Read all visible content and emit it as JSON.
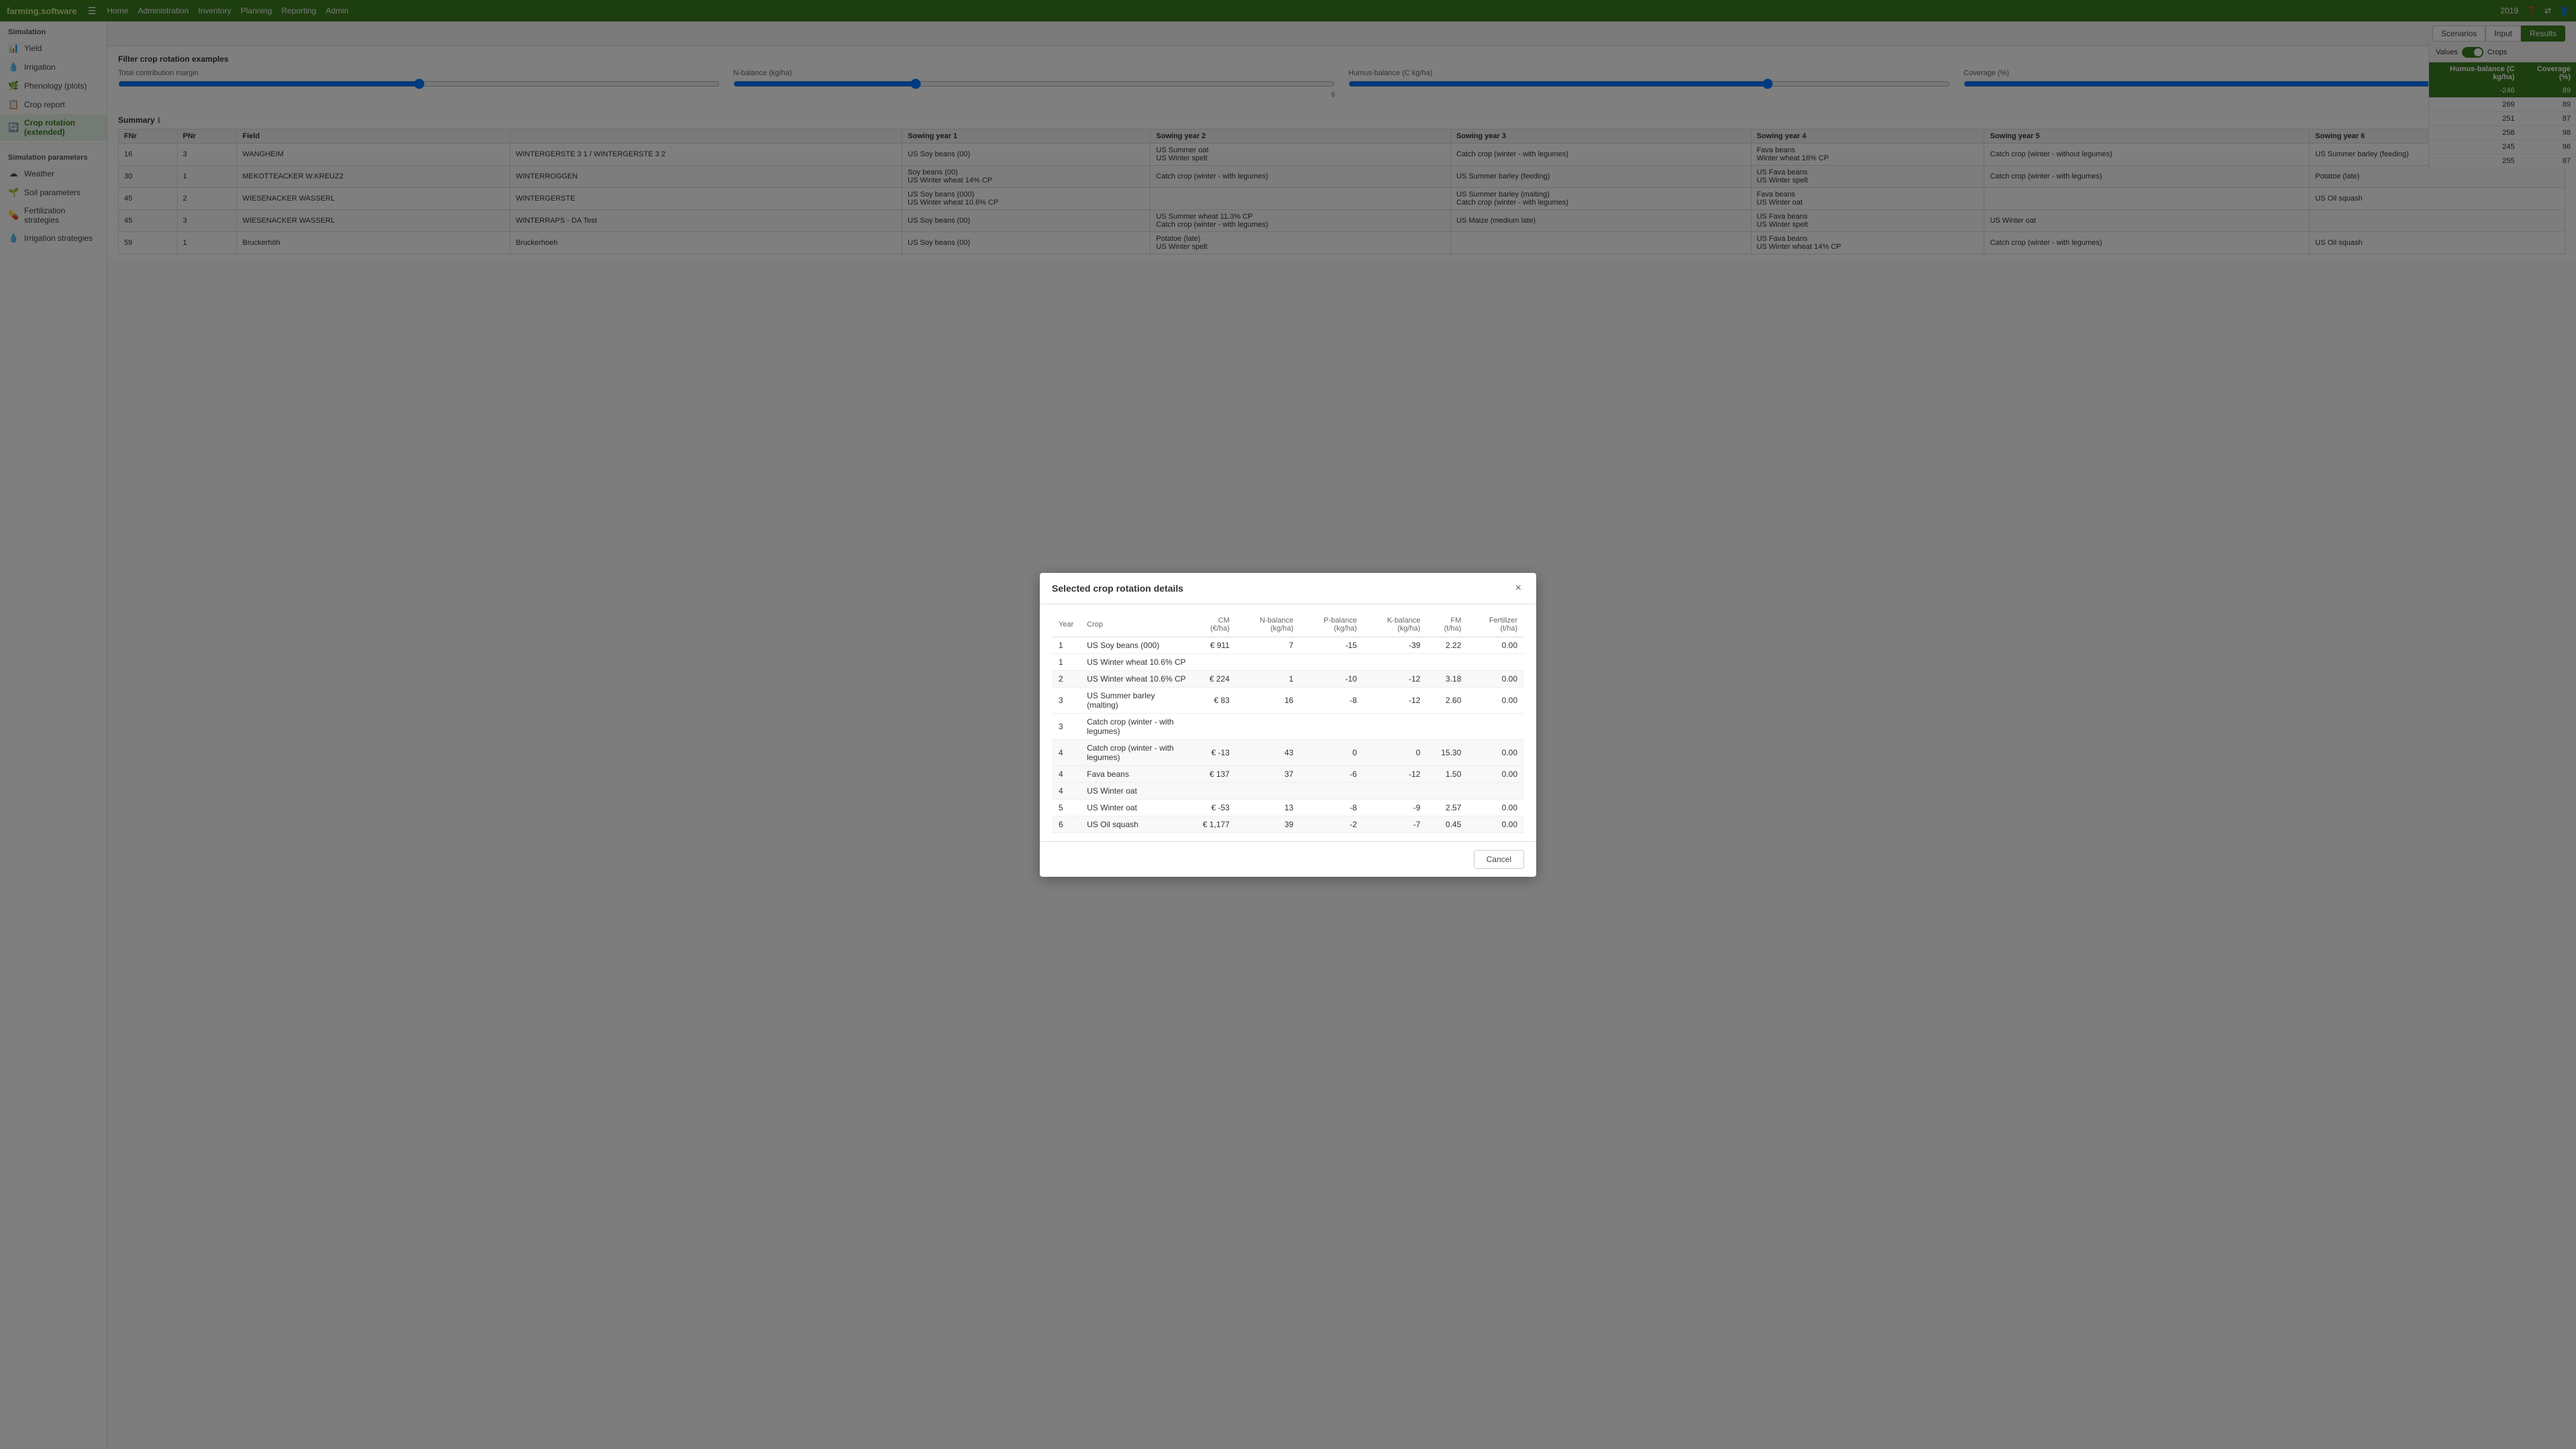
{
  "app": {
    "brand_prefix": "farming.",
    "brand_suffix": "software",
    "year": "2019"
  },
  "nav": {
    "items": [
      "Home",
      "Administration",
      "Inventory",
      "Planning",
      "Reporting",
      "Admin"
    ]
  },
  "sidebar": {
    "simulation_title": "Simulation",
    "sim_items": [
      {
        "label": "Yield",
        "icon": "📊"
      },
      {
        "label": "Irrigation",
        "icon": "💧"
      },
      {
        "label": "Phenology (plots)",
        "icon": "🌿"
      },
      {
        "label": "Crop report",
        "icon": "📋"
      },
      {
        "label": "Crop rotation (extended)",
        "icon": "🔄"
      }
    ],
    "params_title": "Simulation parameters",
    "param_items": [
      {
        "label": "Weather",
        "icon": "☁"
      },
      {
        "label": "Soil parameters",
        "icon": "🌱"
      },
      {
        "label": "Fertilization strategies",
        "icon": "💊"
      },
      {
        "label": "Irrigation strategies",
        "icon": "💧"
      }
    ]
  },
  "toolbar": {
    "scenarios_label": "Scenarios",
    "input_label": "Input",
    "results_label": "Results",
    "values_label": "Values",
    "crops_label": "Crops"
  },
  "filter": {
    "title": "Filter crop rotation examples",
    "total_cm_label": "Total contribution margin",
    "n_balance_label": "N-balance (kg/ha)",
    "humus_balance_label": "Humus-balance (C kg/ha)",
    "coverage_label": "Coverage (%)",
    "n_value": "6"
  },
  "summary": {
    "title": "Summary",
    "columns": [
      "FNr",
      "PNr",
      "Field",
      "",
      "Sowing year 1",
      "",
      "Sowing year 2",
      "",
      "Sowing year 3",
      "",
      "Sowing year 4",
      "",
      "Sowing year 5",
      "Sowing year 6"
    ],
    "rows": [
      {
        "fnr": "16",
        "pnr": "3",
        "field": "WANGHEIM",
        "type": "WINTERGERSTE 3 1 / WINTERGERSTE 3 2",
        "sy1": "US Soy beans (00)",
        "sy2": "US Summer oat\nUS Winter spelt",
        "sy3": "Catch crop (winter - with legumes)",
        "sy4": "Fava beans\nWinter wheat 16% CP",
        "sy5": "Catch crop (winter - without legumes)",
        "sy6": "US Summer barley (feeding)"
      },
      {
        "fnr": "30",
        "pnr": "1",
        "field": "MEKOTTEACKER W.KREUZ2",
        "type": "WINTERROGGEN",
        "sy1": "Soy beans (00)\nUS Winter wheat 14% CP",
        "sy2": "Catch crop (winter - with legumes)",
        "sy3": "US Summer barley (feeding)",
        "sy4": "US Fava beans\nUS Winter spelt",
        "sy5": "Catch crop (winter - with legumes)",
        "sy6": "Potatoe (late)"
      },
      {
        "fnr": "45",
        "pnr": "2",
        "field": "WIESENACKER WASSERL",
        "type": "WINTERGERSTE",
        "sy1": "US Soy beans (000)\nUS Winter wheat 10.6% CP",
        "sy2": "",
        "sy3": "US Summer barley (malting)\nCatch crop (winter - with legumes)",
        "sy4": "Fava beans\nUS Winter oat",
        "sy5": "",
        "sy6": "US Oil squash"
      },
      {
        "fnr": "45",
        "pnr": "3",
        "field": "WIESENACKER WASSERL",
        "type": "WINTERRAPS - DA Test",
        "sy1": "US Soy beans (00)",
        "sy2": "US Summer wheat 11.3% CP\nCatch crop (winter - with legumes)",
        "sy3": "US Maize (medium late)",
        "sy4": "US Fava beans\nUS Winter spelt",
        "sy5": "US Winter oat",
        "sy6": ""
      },
      {
        "fnr": "59",
        "pnr": "1",
        "field": "Bruckerhöh",
        "type": "Bruckerhoeh",
        "sy1": "US Soy beans (00)",
        "sy2": "Potatoe (late)\nUS Winter spelt",
        "sy3": "",
        "sy4": "US Fava beans\nUS Winter wheat 14% CP",
        "sy5": "Catch crop (winter - with legumes)",
        "sy6": "US Oil squash"
      }
    ]
  },
  "right_panel": {
    "humus_col": "Humus-balance (C kg/ha)",
    "coverage_col": "Coverage (%)",
    "rows": [
      {
        "humus": "-246",
        "coverage": "89",
        "highlighted": true
      },
      {
        "humus": "269",
        "coverage": "89"
      },
      {
        "humus": "251",
        "coverage": "87"
      },
      {
        "humus": "258",
        "coverage": "98"
      },
      {
        "humus": "245",
        "coverage": "96"
      },
      {
        "humus": "255",
        "coverage": "87"
      }
    ]
  },
  "modal": {
    "title": "Selected crop rotation details",
    "columns": [
      "Year",
      "Crop",
      "CM (€/ha)",
      "N-balance (kg/ha)",
      "P-balance (kg/ha)",
      "K-balance (kg/ha)",
      "FM (t/ha)",
      "Fertilizer (t/ha)"
    ],
    "rows": [
      {
        "year": "1",
        "crop": "US Soy beans (000)",
        "cm": "€ 911",
        "n": "7",
        "p": "-15",
        "k": "-39",
        "fm": "2.22",
        "fert": "0.00",
        "group": 1
      },
      {
        "year": "1",
        "crop": "US Winter wheat 10.6% CP",
        "cm": "",
        "n": "",
        "p": "",
        "k": "",
        "fm": "",
        "fert": "",
        "group": 1
      },
      {
        "year": "2",
        "crop": "US Winter wheat 10.6% CP",
        "cm": "€ 224",
        "n": "1",
        "p": "-10",
        "k": "-12",
        "fm": "3.18",
        "fert": "0.00",
        "group": 2
      },
      {
        "year": "3",
        "crop": "US Summer barley (malting)",
        "cm": "€ 83",
        "n": "16",
        "p": "-8",
        "k": "-12",
        "fm": "2.60",
        "fert": "0.00",
        "group": 3
      },
      {
        "year": "3",
        "crop": "Catch crop (winter - with legumes)",
        "cm": "",
        "n": "",
        "p": "",
        "k": "",
        "fm": "",
        "fert": "",
        "group": 3
      },
      {
        "year": "4",
        "crop": "Catch crop (winter - with legumes)",
        "cm": "€ -13",
        "n": "43",
        "p": "0",
        "k": "0",
        "fm": "15.30",
        "fert": "0.00",
        "group": 4
      },
      {
        "year": "4",
        "crop": "Fava beans",
        "cm": "€ 137",
        "n": "37",
        "p": "-6",
        "k": "-12",
        "fm": "1.50",
        "fert": "0.00",
        "group": 4
      },
      {
        "year": "4",
        "crop": "US Winter oat",
        "cm": "",
        "n": "",
        "p": "",
        "k": "",
        "fm": "",
        "fert": "",
        "group": 4
      },
      {
        "year": "5",
        "crop": "US Winter oat",
        "cm": "€ -53",
        "n": "13",
        "p": "-8",
        "k": "-9",
        "fm": "2.57",
        "fert": "0.00",
        "group": 5
      },
      {
        "year": "6",
        "crop": "US Oil squash",
        "cm": "€ 1,177",
        "n": "39",
        "p": "-2",
        "k": "-7",
        "fm": "0.45",
        "fert": "0.00",
        "group": 6
      }
    ],
    "cancel_label": "Cancel"
  }
}
